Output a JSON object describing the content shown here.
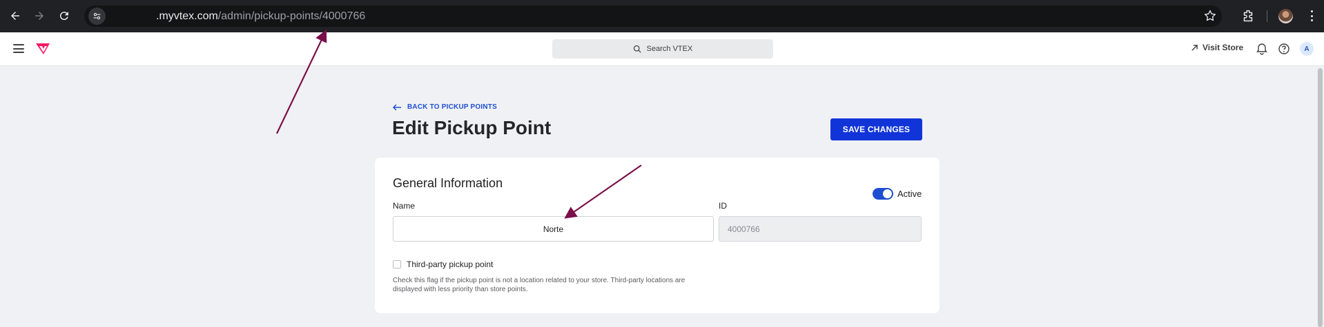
{
  "browser": {
    "url_host": ".myvtex.com",
    "url_path": "/admin/pickup-points/4000766",
    "icons": [
      "back-icon",
      "forward-icon",
      "reload-icon",
      "site-info-icon",
      "bookmark-star-icon",
      "extensions-icon",
      "profile-avatar",
      "menu-icon"
    ]
  },
  "header": {
    "search_placeholder": "Search VTEX",
    "visit_store": "Visit Store",
    "avatar_letter": "A"
  },
  "page": {
    "back_link": "BACK TO PICKUP POINTS",
    "title": "Edit Pickup Point",
    "save_button": "SAVE CHANGES"
  },
  "general": {
    "section_title": "General Information",
    "active_label": "Active",
    "active": true,
    "name_label": "Name",
    "name_value": "Norte",
    "id_label": "ID",
    "id_value": "4000766",
    "third_party_label": "Third-party pickup point",
    "third_party_checked": false,
    "help_text": "Check this flag if the pickup point is not a location related to your store. Third-party locations are displayed with less priority than store points."
  },
  "colors": {
    "accent": "#1134d9",
    "annotation": "#7a0f4a"
  }
}
